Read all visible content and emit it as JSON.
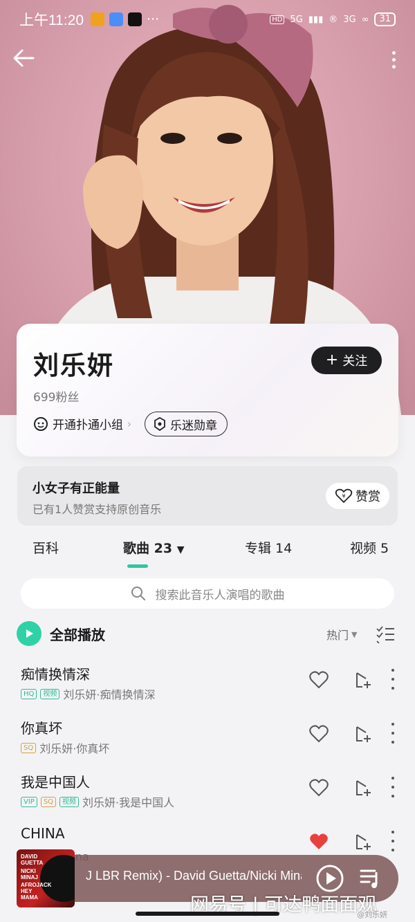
{
  "status_bar": {
    "time": "上午11:20",
    "more": "···",
    "signal1": "5G",
    "signal2": "3G",
    "battery": "31"
  },
  "artist": {
    "name": "刘乐妍",
    "fans": "699粉丝",
    "follow_label": "关注",
    "group_label": "开通扑通小组",
    "badge_label": "乐迷勋章"
  },
  "reward": {
    "title": "小女子有正能量",
    "subtitle": "已有1人赞赏支持原创音乐",
    "button_label": "赞赏"
  },
  "tabs": [
    {
      "label": "百科"
    },
    {
      "label": "歌曲 23"
    },
    {
      "label": "专辑 14"
    },
    {
      "label": "视频 5"
    }
  ],
  "search": {
    "placeholder": "搜索此音乐人演唱的歌曲"
  },
  "play_all": {
    "label": "全部播放",
    "sort_label": "热门"
  },
  "songs": [
    {
      "name": "痴情换情深",
      "tags": [
        "HQ",
        "视频"
      ],
      "meta": "刘乐妍·痴情换情深",
      "liked": false
    },
    {
      "name": "你真坏",
      "tags": [
        "SQ"
      ],
      "meta": "刘乐妍·你真坏",
      "liked": false
    },
    {
      "name": "我是中国人",
      "tags": [
        "VIP",
        "SQ",
        "视频"
      ],
      "meta": "刘乐妍·我是中国人",
      "liked": false
    },
    {
      "name": "CHINA",
      "tags": [],
      "meta": "刘乐妍·China",
      "liked": true
    }
  ],
  "player": {
    "track": "J LBR Remix) - David Guetta/Nicki Minaj",
    "cover_text": [
      "DAVID",
      "GUETTA",
      "NICKI",
      "MINAJ",
      "AFROJACK",
      "HEY",
      "MAMA"
    ]
  },
  "watermark": {
    "main": "网易号 | 可达鸭面面观",
    "small": "@刘乐妍"
  },
  "colors": {
    "accent": "#2fc6a1",
    "like": "#e8413d",
    "dark_button": "#1f1f22"
  }
}
